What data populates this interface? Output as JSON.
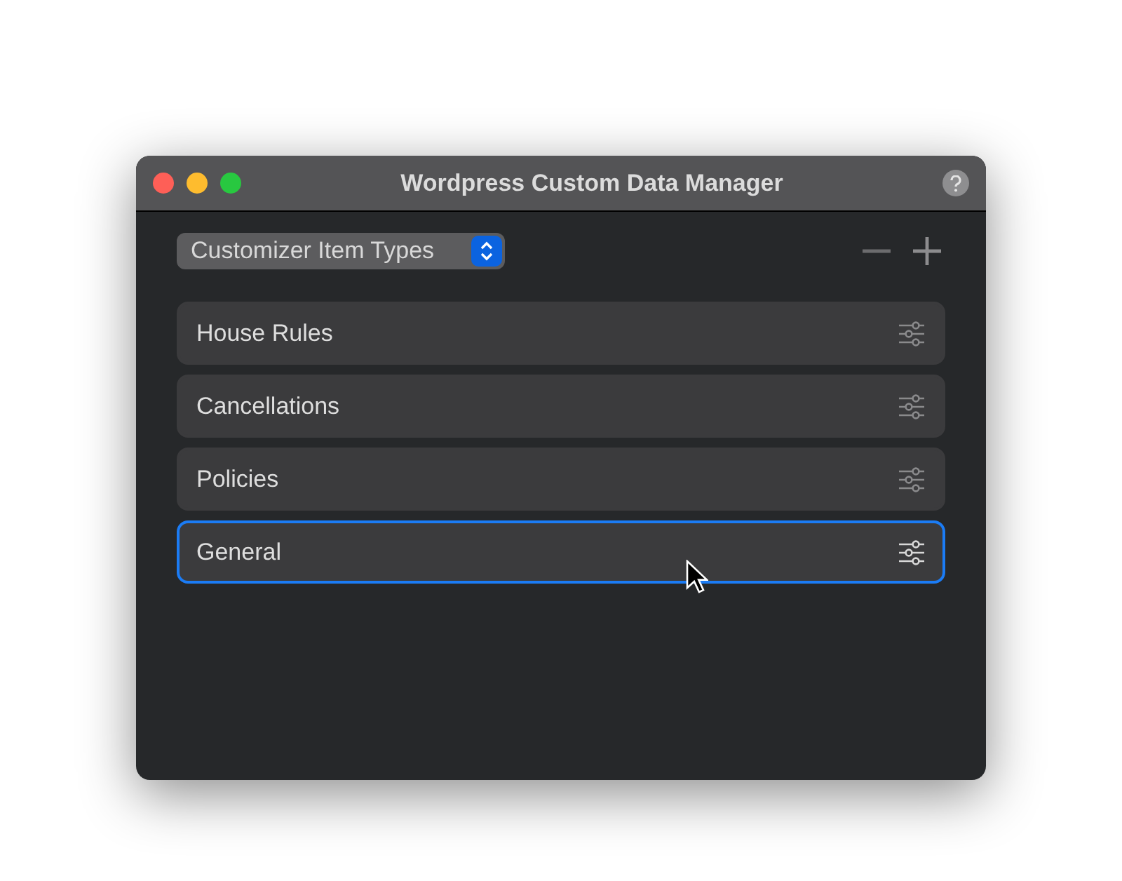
{
  "window": {
    "title": "Wordpress Custom Data Manager"
  },
  "type_selector": {
    "value": "Customizer Item Types"
  },
  "items": [
    {
      "label": "House Rules",
      "selected": false
    },
    {
      "label": "Cancellations",
      "selected": false
    },
    {
      "label": "Policies",
      "selected": false
    },
    {
      "label": "General",
      "selected": true
    }
  ]
}
